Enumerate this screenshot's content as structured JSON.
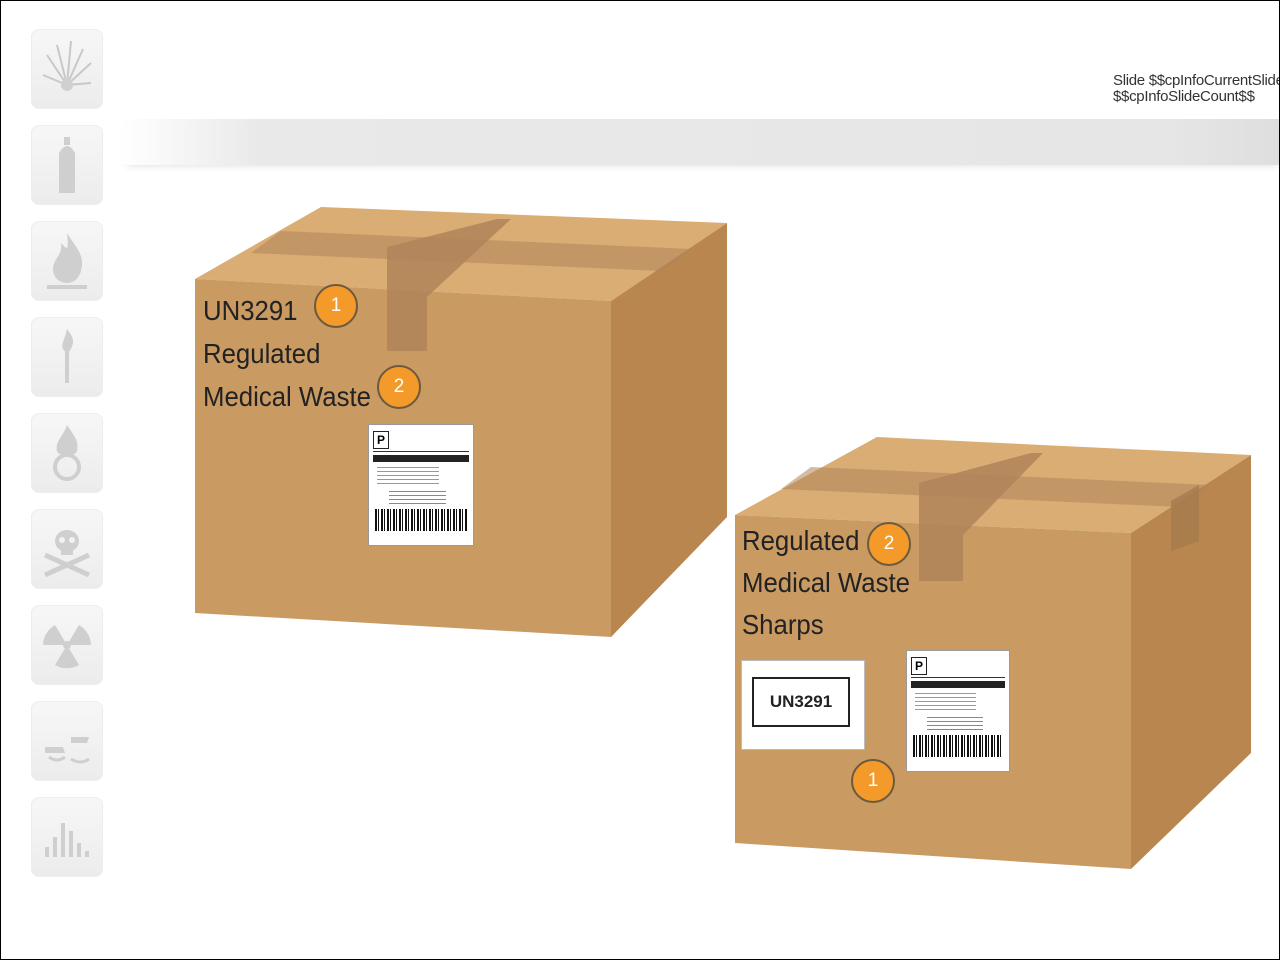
{
  "header": {
    "slide_info_line1": "Slide $$cpInfoCurrentSlide$$ of",
    "slide_info_line2": "$$cpInfoSlideCount$$"
  },
  "sidebar": {
    "icons": [
      "explosive-icon",
      "gas-cylinder-icon",
      "flammable-icon",
      "flammable-solid-icon",
      "oxidizer-icon",
      "toxic-skull-icon",
      "radioactive-icon",
      "corrosive-icon",
      "miscellaneous-icon"
    ]
  },
  "box1": {
    "line1": "UN3291",
    "line2": "Regulated",
    "line3": "Medical Waste",
    "marker1": "1",
    "marker2": "2"
  },
  "box2": {
    "line1": "Regulated",
    "line2": "Medical Waste",
    "line3": "Sharps",
    "marker1": "1",
    "marker2": "2",
    "un_label": "UN3291"
  },
  "shipping_label": {
    "service_letter": "P"
  },
  "colors": {
    "box_front": "#c99a61",
    "box_top": "#d9ad74",
    "tape": "#b0845a",
    "marker": "#f39a2a"
  }
}
